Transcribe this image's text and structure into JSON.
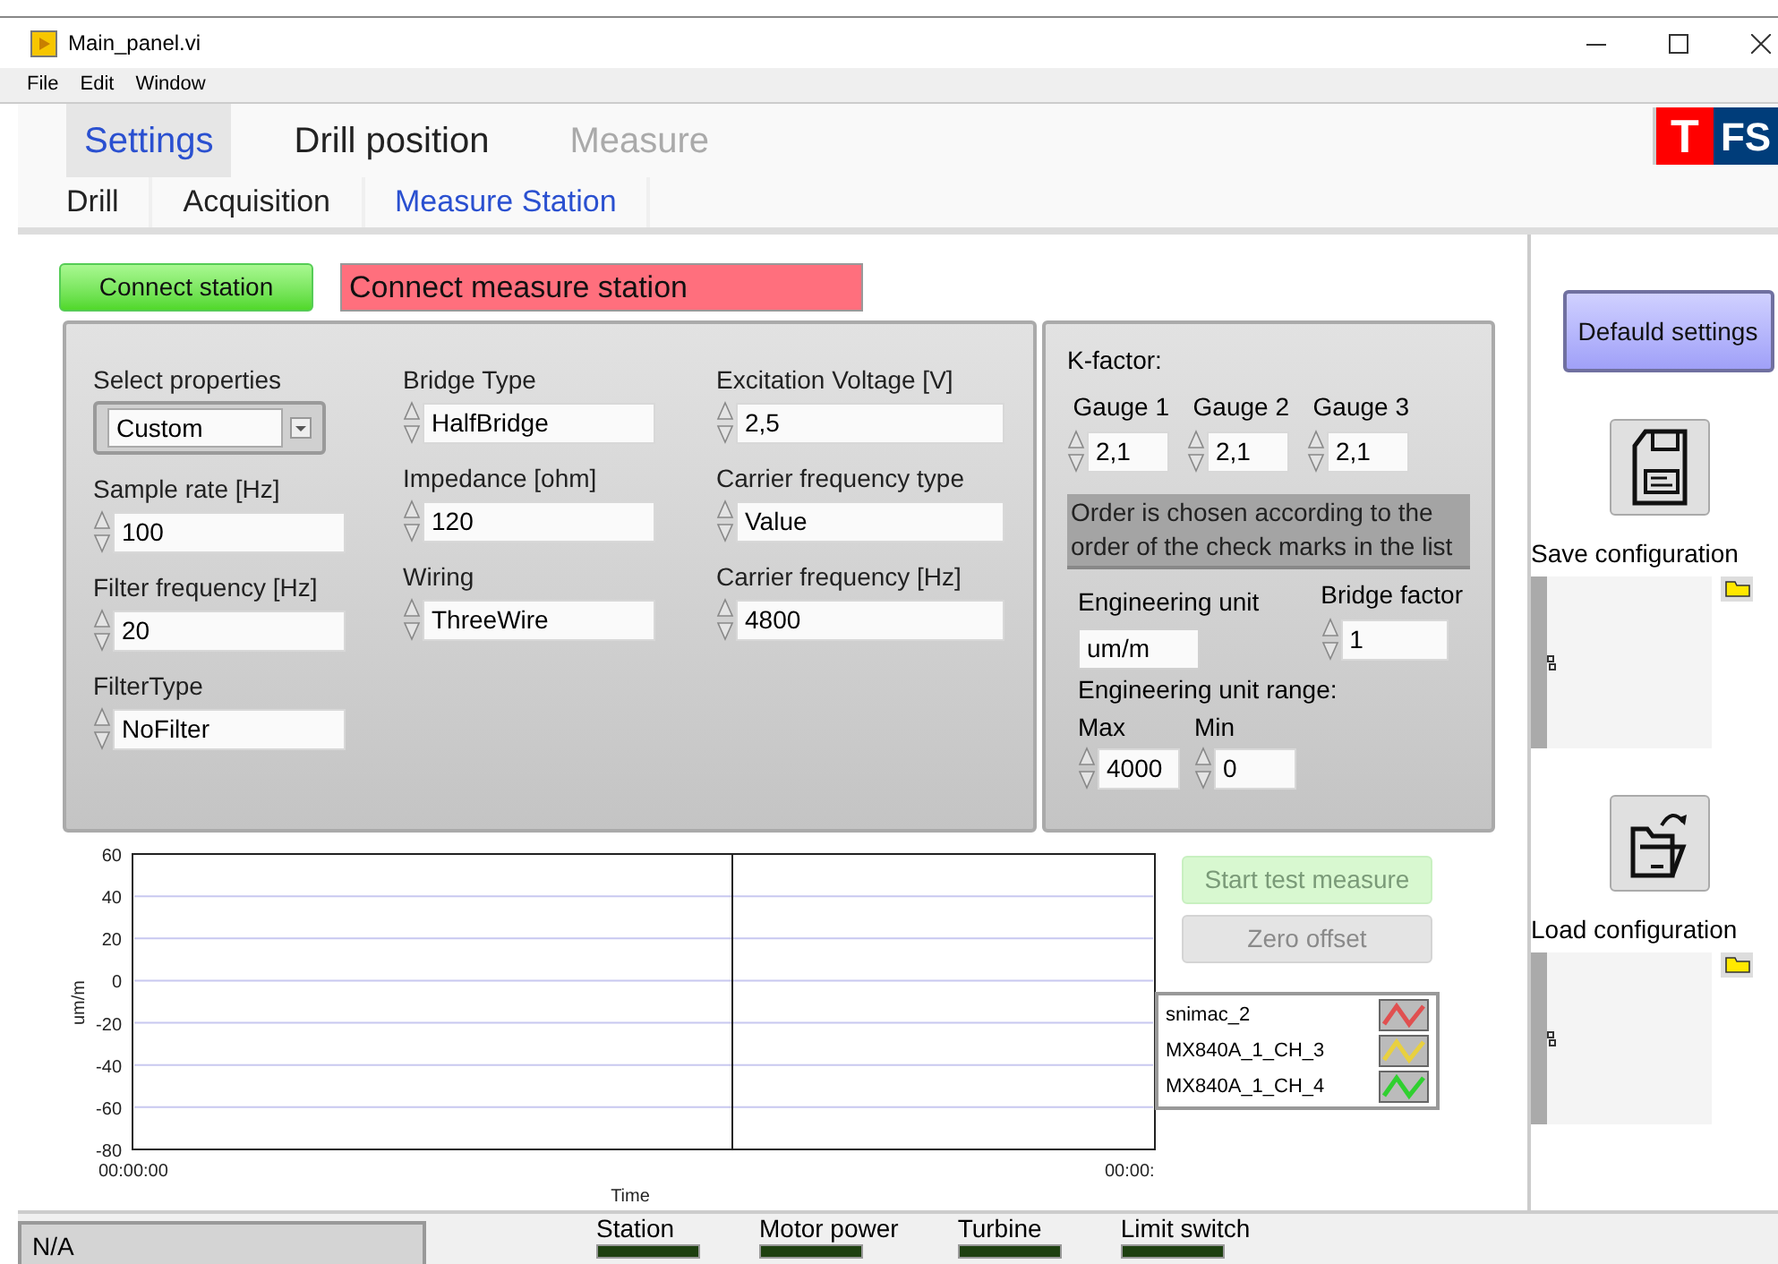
{
  "window": {
    "title": "Main_panel.vi"
  },
  "menu": [
    "File",
    "Edit",
    "Window"
  ],
  "tabs": [
    {
      "label": "Settings",
      "selected": true,
      "disabled": false
    },
    {
      "label": "Drill position",
      "selected": false,
      "disabled": false
    },
    {
      "label": "Measure",
      "selected": false,
      "disabled": true
    }
  ],
  "logo": {
    "mark": "T",
    "text": "FS"
  },
  "subtabs": [
    {
      "label": "Drill",
      "selected": false
    },
    {
      "label": "Acquisition",
      "selected": false
    },
    {
      "label": "Measure Station",
      "selected": true
    }
  ],
  "connect_button": {
    "label": "Connect station"
  },
  "status_banner": {
    "text": "Connect measure station",
    "color": "#ff6f7d"
  },
  "properties": {
    "columns": [
      [
        {
          "label": "Select properties",
          "value": "Custom",
          "kind": "dropdown"
        },
        {
          "label": "Sample rate [Hz]",
          "value": "100",
          "kind": "numeric"
        },
        {
          "label": "Filter frequency [Hz]",
          "value": "20",
          "kind": "numeric"
        },
        {
          "label": "FilterType",
          "value": "NoFilter",
          "kind": "numeric"
        }
      ],
      [
        {
          "label": "Bridge Type",
          "value": "HalfBridge",
          "kind": "numeric"
        },
        {
          "label": "Impedance  [ohm]",
          "value": "120",
          "kind": "numeric"
        },
        {
          "label": "Wiring",
          "value": "ThreeWire",
          "kind": "numeric"
        }
      ],
      [
        {
          "label": "Excitation Voltage [V]",
          "value": "2,5",
          "kind": "numeric"
        },
        {
          "label": "Carrier frequency type",
          "value": "Value",
          "kind": "numeric"
        },
        {
          "label": "Carrier frequency [Hz]",
          "value": "4800",
          "kind": "numeric"
        }
      ]
    ]
  },
  "kfactor": {
    "title": "K-factor:",
    "gauges": [
      {
        "label": "Gauge 1",
        "value": "2,1"
      },
      {
        "label": "Gauge 2",
        "value": "2,1"
      },
      {
        "label": "Gauge 3",
        "value": "2,1"
      }
    ],
    "note": "Order is chosen according to the order of the check marks in the list",
    "engineering_unit": {
      "label": "Engineering unit",
      "value": "um/m"
    },
    "bridge_factor": {
      "label": "Bridge factor",
      "value": "1"
    },
    "range": {
      "label": "Engineering unit range:",
      "fields": [
        {
          "label": "Max",
          "value": "4000"
        },
        {
          "label": "Min",
          "value": "0"
        }
      ]
    }
  },
  "chart": {
    "y_label": "um/m",
    "y_ticks": [
      "60",
      "40",
      "20",
      "0",
      "-20",
      "-40",
      "-60",
      "-80"
    ],
    "x_labels": [
      "00:00:00",
      "00:00:"
    ],
    "x_label": "Time"
  },
  "start_button": {
    "label": "Start test measure",
    "disabled": true
  },
  "zero_button": {
    "label": "Zero offset",
    "disabled": true
  },
  "legend": [
    {
      "name": "snimac_2",
      "color": "#e05050"
    },
    {
      "name": "MX840A_1_CH_3",
      "color": "#e8d040"
    },
    {
      "name": "MX840A_1_CH_4",
      "color": "#30d030"
    }
  ],
  "default_button": {
    "label": "Defauld settings"
  },
  "save": {
    "label": "Save configuration"
  },
  "load": {
    "label": "Load configuration"
  },
  "status_bar": {
    "text": "N/A",
    "indicators": [
      {
        "label": "Station",
        "on": false
      },
      {
        "label": "Motor power",
        "on": false
      },
      {
        "label": "Turbine",
        "on": false
      },
      {
        "label": "Limit switch",
        "on": false
      }
    ]
  }
}
